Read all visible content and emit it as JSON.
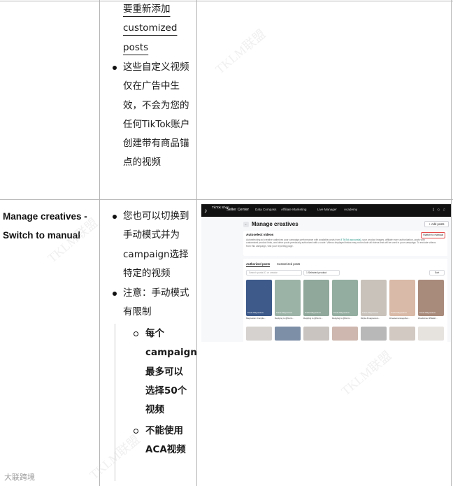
{
  "top_row": {
    "continuation_lines": [
      "要重新添加",
      "customized",
      "posts"
    ],
    "bullet_lines": [
      "这些自定义视频",
      "仅在广告中生",
      "效，不会为您的",
      "任何TikTok账户",
      "创建带有商品锚",
      "点的视频"
    ]
  },
  "row_label": "Manage creatives - Switch to manual",
  "bullets": {
    "b1_lines": [
      "您也可以切换到",
      "手动模式并为",
      "campaign选择",
      "特定的视频"
    ],
    "b2_lines": [
      "注意：手动模式",
      "有限制"
    ],
    "sub1_lines": [
      "每个",
      "campaign",
      "最多可以",
      "选择50个",
      "视频"
    ],
    "sub2_lines": [
      "不能使用",
      "ACA视频"
    ]
  },
  "screenshot": {
    "logo_text": "TikTok Shop",
    "brand": "Seller Center",
    "nav": [
      "Data Compass",
      "Affiliate Marketing",
      "Live Manager",
      "Academy"
    ],
    "title": "Manage creatives",
    "add_posts": "+ Add posts",
    "autoselect_title": "Autoselect videos",
    "autoselect_text_a": "Autoselecting ad creative optimizes your campaign performance with available posts from ",
    "autoselect_link": "8 TikTok account(s)",
    "autoselect_text_b": ", your product images, affiliate more authorization, posts with customized product links, and other posts previously authorized with a code. Videos displayed below may not include all videos that will be used in your campaign. To exclude videos from this campaign, visit your reporting page.",
    "switch_btn": "Switch to manual",
    "tabs": [
      "Authorized posts",
      "Customized posts"
    ],
    "search_placeholder": "Search posts ID or creator",
    "select_value": "1 Selected product",
    "sort": "Sort",
    "thumbs": [
      {
        "label": "Trade Magnesium",
        "caption": "Magnesium Comple...",
        "bg": "#3d5a8a"
      },
      {
        "label": "Trade Magnesium",
        "caption": "Replying to @Norm...",
        "bg": "#9bb3a7"
      },
      {
        "label": "Trade Magnesium",
        "caption": "Replying to @Norm...",
        "bg": "#8fa89b"
      },
      {
        "label": "Trade Magnesium",
        "caption": "Replying to @Norm...",
        "bg": "#93aea0"
      },
      {
        "label": "Trade Magnesium",
        "caption": "#triple #magnesium...",
        "bg": "#c8c2bb"
      },
      {
        "label": "Trade Magnesium",
        "caption": "#createmoretogether...",
        "bg": "#d9b9a7"
      },
      {
        "label": "Trade Magnesium",
        "caption": "#Godstimer #Walsh...",
        "bg": "#a98b7c"
      }
    ]
  },
  "watermark": "TKLM联盟",
  "footer_logo": "大联跨境"
}
